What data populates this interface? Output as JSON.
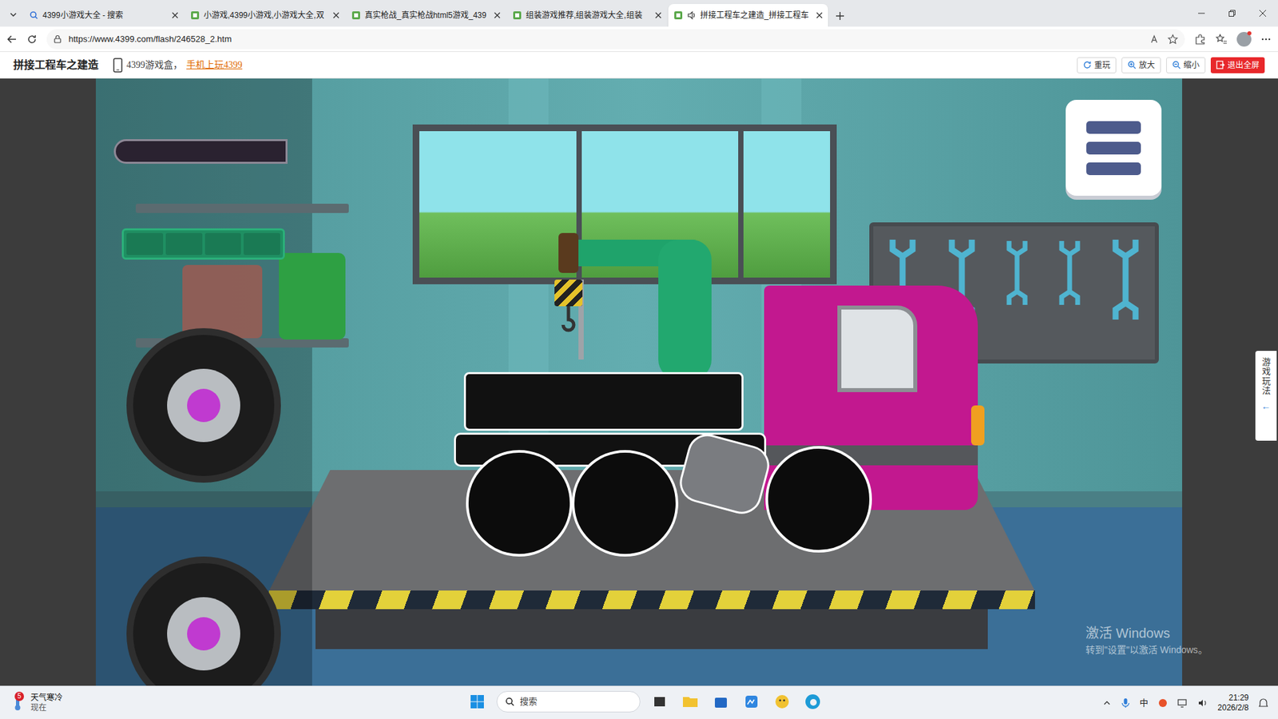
{
  "browser": {
    "tabs": [
      {
        "label": "4399小游戏大全 - 搜索",
        "selected": false
      },
      {
        "label": "小游戏,4399小游戏,小游戏大全,双",
        "selected": false
      },
      {
        "label": "真实枪战_真实枪战html5游戏_439",
        "selected": false
      },
      {
        "label": "组装游戏推荐,组装游戏大全,组装",
        "selected": false
      },
      {
        "label": "拼接工程车之建造_拼接工程车",
        "selected": true
      }
    ],
    "address": "https://www.4399.com/flash/246528_2.htm"
  },
  "site_header": {
    "title": "拼接工程车之建造",
    "promo_prefix": "4399游戏盒，",
    "promo_link": "手机上玩4399",
    "buttons": [
      "重玩",
      "放大",
      "缩小",
      "退出全屏"
    ]
  },
  "game": {
    "side_tab": "游戏玩法",
    "side_tab_arrow": "←"
  },
  "watermark": {
    "title": "激活 Windows",
    "subtitle": "转到\"设置\"以激活 Windows。"
  },
  "taskbar": {
    "weather": {
      "badge": "5",
      "title": "天气寒冷",
      "subtitle": "现在"
    },
    "search": "搜索",
    "ime": "中",
    "time": "21:29",
    "date": "2026/2/8"
  }
}
